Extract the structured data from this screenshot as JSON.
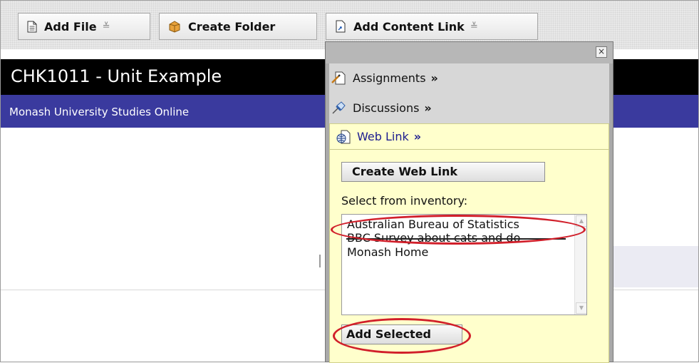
{
  "toolbar": {
    "add_file": "Add File",
    "create_folder": "Create Folder",
    "add_content_link": "Add Content Link",
    "dropdown_glyph": "≚"
  },
  "header": {
    "unit_title": "CHK1011 - Unit Example",
    "subtitle": "Monash University Studies Online"
  },
  "popup": {
    "close": "×",
    "menu": [
      {
        "label": "Assignments",
        "arrow": "»",
        "icon": "assignments-icon"
      },
      {
        "label": "Discussions",
        "arrow": "»",
        "icon": "pushpin-icon"
      }
    ],
    "web_link": {
      "label": "Web Link",
      "arrow": "»",
      "icon": "globe-icon"
    },
    "create_button": "Create Web Link",
    "inventory_label": "Select from inventory:",
    "inventory": [
      "Australian Bureau of Statistics",
      "BBC Survey about cats and do",
      "Monash Home"
    ],
    "add_selected": "Add Selected"
  },
  "colors": {
    "header_bg": "#000000",
    "subbar_bg": "#3a3a9e",
    "panel_bg": "#ffffcc",
    "annotation": "#d11f2a",
    "web_link_text": "#1b1b8f"
  }
}
